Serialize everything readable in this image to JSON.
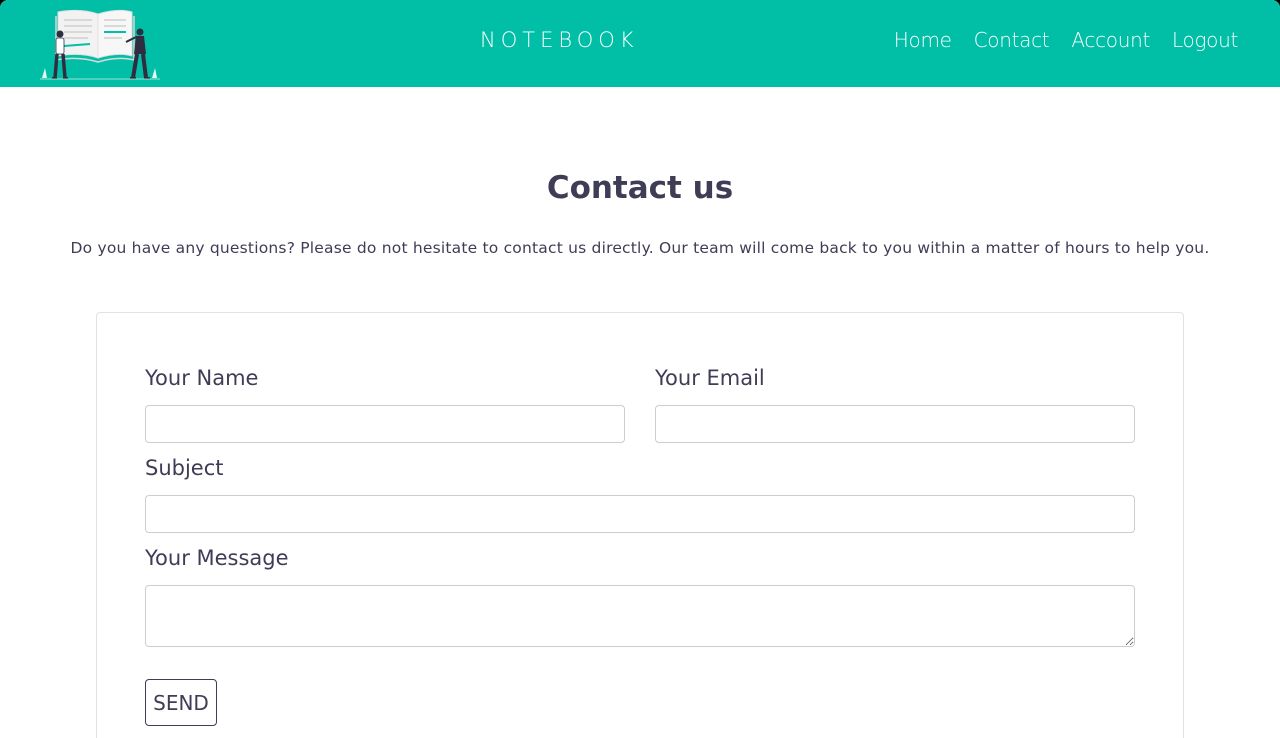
{
  "nav": {
    "brand": "NOTEBOOK",
    "links": [
      "Home",
      "Contact",
      "Account",
      "Logout"
    ]
  },
  "contact": {
    "title": "Contact us",
    "intro": "Do you have any questions? Please do not hesitate to contact us directly. Our team will come back to you within a matter of hours to help you.",
    "name_label": "Your Name",
    "name_value": "",
    "email_label": "Your Email",
    "email_value": "",
    "subject_label": "Subject",
    "subject_value": "",
    "message_label": "Your Message",
    "message_value": "",
    "send_label": "SEND"
  },
  "colors": {
    "navbar": "#00bfa6",
    "text": "#3f3d56"
  },
  "icons": {
    "logo": "open-book-with-people-illustration"
  }
}
